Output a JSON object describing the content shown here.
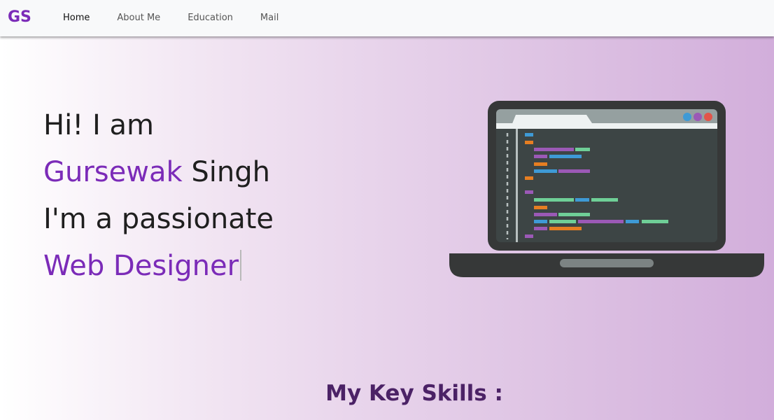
{
  "navbar": {
    "brand": "GS",
    "links": [
      {
        "label": "Home",
        "active": true
      },
      {
        "label": "About Me",
        "active": false
      },
      {
        "label": "Education",
        "active": false
      },
      {
        "label": "Mail",
        "active": false
      }
    ]
  },
  "hero": {
    "line1": "Hi! I am",
    "first_name": "Gursewak",
    "last_name": "Singh",
    "line3": "I'm a passionate",
    "role": "Web Designer"
  },
  "illustration": {
    "icon": "laptop-code-icon"
  },
  "skills": {
    "title": "My Key Skills :"
  },
  "colors": {
    "accent": "#7b2bb8",
    "heading": "#4b2266",
    "navbar_bg": "#f8f9fa",
    "text": "#1f1f1f"
  }
}
